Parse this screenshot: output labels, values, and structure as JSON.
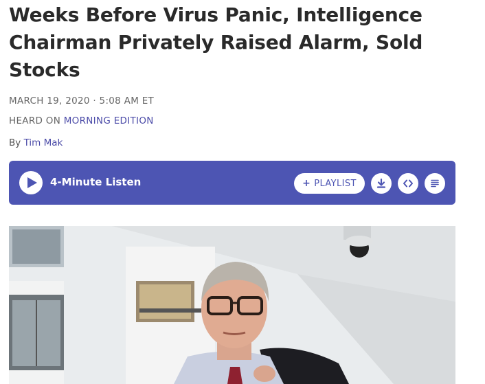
{
  "article": {
    "headline": "Weeks Before Virus Panic, Intelligence Chairman Privately Raised Alarm, Sold Stocks",
    "dateline": "MARCH 19, 2020 · 5:08 AM ET",
    "heard_on_prefix": "HEARD ON",
    "heard_on_show": "MORNING EDITION",
    "byline_prefix": "By",
    "byline_author": "Tim Mak"
  },
  "player": {
    "listen_label": "4-Minute Listen",
    "playlist_label": "PLAYLIST",
    "accent_color": "#4d55b3",
    "icons": [
      "play-icon",
      "plus-icon",
      "download-icon",
      "embed-icon",
      "transcript-icon"
    ]
  },
  "photo": {
    "subject": "photo-of-man-with-glasses"
  }
}
